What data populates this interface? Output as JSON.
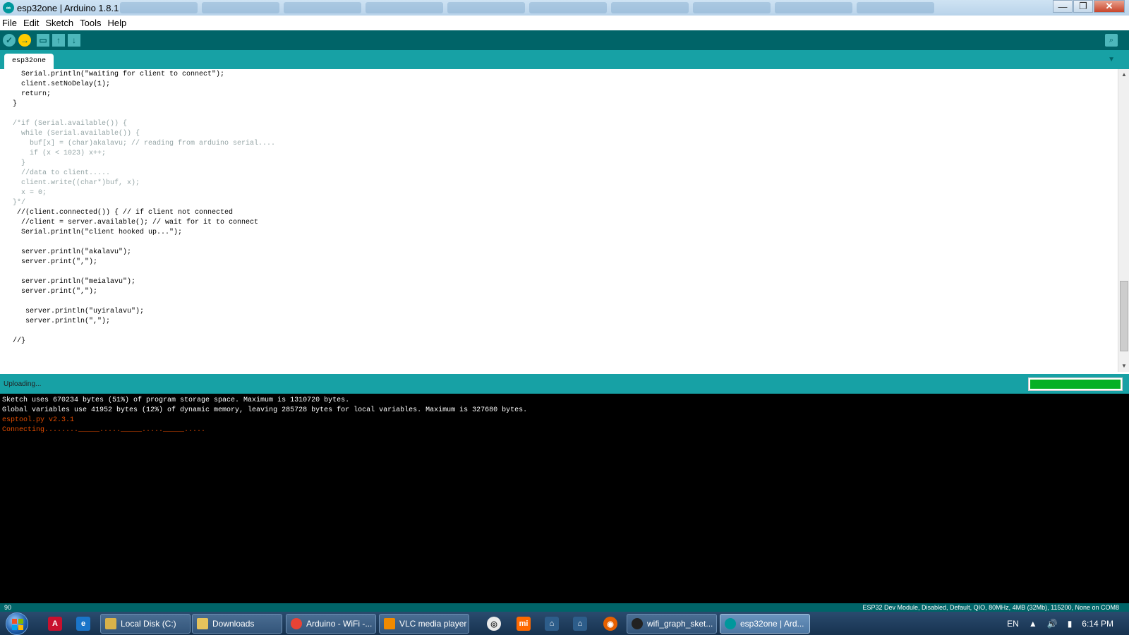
{
  "window": {
    "title": "esp32one | Arduino 1.8.1",
    "minimize": "—",
    "maximize": "❐",
    "close": "✕"
  },
  "menu": {
    "items": [
      "File",
      "Edit",
      "Sketch",
      "Tools",
      "Help"
    ]
  },
  "toolbar": {
    "verify": "✓",
    "upload": "→",
    "new": "▭",
    "open": "↑",
    "save": "↓",
    "serial_monitor": "⌕"
  },
  "tabs": {
    "active": "esp32one",
    "menu": "▼"
  },
  "code_lines": [
    {
      "text": "    Serial.println(\"waiting for client to connect\");",
      "style": "normal"
    },
    {
      "text": "    client.setNoDelay(1);",
      "style": "normal"
    },
    {
      "text": "    return;",
      "style": "normal"
    },
    {
      "text": "  }",
      "style": "normal"
    },
    {
      "text": "",
      "style": "normal"
    },
    {
      "text": "  /*if (Serial.available()) {",
      "style": "muted"
    },
    {
      "text": "    while (Serial.available()) {",
      "style": "muted"
    },
    {
      "text": "      buf[x] = (char)akalavu; // reading from arduino serial....",
      "style": "muted"
    },
    {
      "text": "      if (x < 1023) x++;",
      "style": "muted"
    },
    {
      "text": "    }",
      "style": "muted"
    },
    {
      "text": "    //data to client.....",
      "style": "muted"
    },
    {
      "text": "    client.write((char*)buf, x);",
      "style": "muted"
    },
    {
      "text": "    x = 0;",
      "style": "muted"
    },
    {
      "text": "  }*/",
      "style": "muted"
    },
    {
      "text": "   //(client.connected()) { // if client not connected",
      "style": "normal"
    },
    {
      "text": "    //client = server.available(); // wait for it to connect",
      "style": "normal"
    },
    {
      "text": "    Serial.println(\"client hooked up...\");",
      "style": "normal"
    },
    {
      "text": "",
      "style": "normal"
    },
    {
      "text": "    server.println(\"akalavu\");",
      "style": "normal"
    },
    {
      "text": "    server.print(\",\");",
      "style": "normal"
    },
    {
      "text": "",
      "style": "normal"
    },
    {
      "text": "    server.println(\"meialavu\");",
      "style": "normal"
    },
    {
      "text": "    server.print(\",\");",
      "style": "normal"
    },
    {
      "text": "",
      "style": "normal"
    },
    {
      "text": "     server.println(\"uyiralavu\");",
      "style": "normal"
    },
    {
      "text": "     server.println(\",\");",
      "style": "normal"
    },
    {
      "text": "",
      "style": "normal"
    },
    {
      "text": "  //}",
      "style": "normal"
    }
  ],
  "status": {
    "text": "Uploading...",
    "progress": 1.0
  },
  "console_lines": [
    {
      "text": "Sketch uses 670234 bytes (51%) of program storage space. Maximum is 1310720 bytes.",
      "color": "white"
    },
    {
      "text": "Global variables use 41952 bytes (12%) of dynamic memory, leaving 285728 bytes for local variables. Maximum is 327680 bytes.",
      "color": "white"
    },
    {
      "text": "esptool.py v2.3.1",
      "color": "orange"
    },
    {
      "text": "Connecting........_____....._____....._____.....",
      "color": "orange"
    }
  ],
  "footer": {
    "line_number": "90",
    "board": "ESP32 Dev Module, Disabled, Default, QIO, 80MHz, 4MB (32Mb), 115200, None on COM8"
  },
  "taskbar": {
    "tasks": [
      {
        "label": "Local Disk (C:)",
        "icon_color": "#d9b24a",
        "active": false
      },
      {
        "label": "Downloads",
        "icon_color": "#e6c35c",
        "active": false
      },
      {
        "label": "Arduino - WiFi -...",
        "icon_color": "#e84335",
        "active": false
      },
      {
        "label": "VLC media player",
        "icon_color": "#f08a00",
        "active": false
      },
      {
        "label": "wifi_graph_sket...",
        "icon_color": "#222222",
        "active": false
      },
      {
        "label": "esp32one | Ard...",
        "icon_color": "#00979c",
        "active": true
      }
    ],
    "pinned_icons": [
      "acrobat-icon",
      "ie-icon",
      "media-icon",
      "mi-icon",
      "putty-icon",
      "putty2-icon",
      "firefox-icon"
    ],
    "language": "EN",
    "clock": "6:14 PM"
  },
  "colors": {
    "teal_dark": "#006468",
    "teal": "#17a1a5",
    "accent_orange": "#e34c00",
    "progress_green": "#06b025"
  }
}
